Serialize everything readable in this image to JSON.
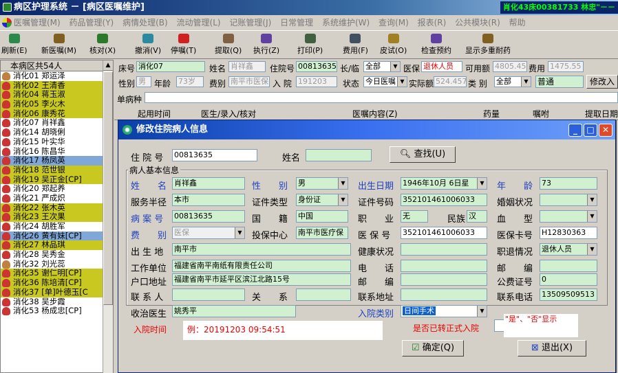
{
  "window": {
    "title": "病区护理系统 － [病区医嘱维护]",
    "status_right": "肖化43床00381733 林忠\"－－"
  },
  "menu": [
    "医嘱管理(M)",
    "药品管理(Y)",
    "病情处理(B)",
    "流动管理(L)",
    "记账管理(J)",
    "日常管理",
    "系统维护(W)",
    "查询(M)",
    "报表(R)",
    "公共模块(R)",
    "帮助"
  ],
  "toolbar": [
    {
      "label": "刷新(E)",
      "icon": "refresh-icon",
      "color": "#2a8a4a"
    },
    {
      "label": "新医嘱(M)",
      "icon": "new-order-icon",
      "color": "#806020"
    },
    {
      "label": "核对(X)",
      "icon": "check-icon",
      "color": "#2a7a2a"
    },
    {
      "label": "撤消(V)",
      "icon": "undo-icon",
      "color": "#2a8aa0"
    },
    {
      "label": "停嘱(T)",
      "icon": "stop-icon",
      "color": "#d02020"
    },
    {
      "label": "提取(Q)",
      "icon": "extract-icon",
      "color": "#806040"
    },
    {
      "label": "执行(Z)",
      "icon": "execute-icon",
      "color": "#6040a0"
    },
    {
      "label": "打印(P)",
      "icon": "print-icon",
      "color": "#406040"
    },
    {
      "label": "费用(F)",
      "icon": "fee-icon",
      "color": "#405060"
    },
    {
      "label": "皮试(O)",
      "icon": "skin-test-icon",
      "color": "#a08020"
    },
    {
      "label": "检查预约",
      "icon": "appointment-icon",
      "color": "#6040a0"
    },
    {
      "label": "显示多重耐药",
      "icon": "drug-resistance-icon",
      "color": "#806020"
    }
  ],
  "patient_list": {
    "header": "本病区共54人",
    "items": [
      {
        "text": "消化01 郑运泽",
        "state": "normal"
      },
      {
        "text": "消化02 王清香",
        "state": "hl"
      },
      {
        "text": "消化04 蒋玉淑",
        "state": "hl"
      },
      {
        "text": "消化05 李火木",
        "state": "hl"
      },
      {
        "text": "消化06 康秀花",
        "state": "hl"
      },
      {
        "text": "消化07 肖祥鑫",
        "state": "normal"
      },
      {
        "text": "消化14 胡晓俐",
        "state": "normal"
      },
      {
        "text": "消化15 叶实华",
        "state": "normal"
      },
      {
        "text": "消化16 陈昌华",
        "state": "normal"
      },
      {
        "text": "消化17 杨凤英",
        "state": "sel"
      },
      {
        "text": "消化18 范世银",
        "state": "hl"
      },
      {
        "text": "消化19 吴正金[CP]",
        "state": "hl"
      },
      {
        "text": "消化20 郑起养",
        "state": "normal"
      },
      {
        "text": "消化21 严成炽",
        "state": "normal"
      },
      {
        "text": "消化22 张木英",
        "state": "hl"
      },
      {
        "text": "消化23 王次果",
        "state": "hl"
      },
      {
        "text": "消化24 胡胜军",
        "state": "normal"
      },
      {
        "text": "消化26 黄有妹[CP]",
        "state": "sel"
      },
      {
        "text": "消化27 林品琪",
        "state": "hl"
      },
      {
        "text": "消化28 吴秀金",
        "state": "normal"
      },
      {
        "text": "消化32 刘光蕊",
        "state": "normal"
      },
      {
        "text": "消化35 谢仁明[CP]",
        "state": "hl"
      },
      {
        "text": "消化36 陈培清[CP]",
        "state": "hl"
      },
      {
        "text": "消化37 [单]叶德玉[C",
        "state": "hl"
      },
      {
        "text": "消化38 吴步霞",
        "state": "normal"
      },
      {
        "text": "消化53 杨成忠[CP]",
        "state": "normal"
      }
    ]
  },
  "order_header": {
    "bed_label": "床号",
    "bed": "消化07",
    "name_label": "姓名",
    "name": "肖祥鑫",
    "inpatient_label": "住院号",
    "inpatient": "00813635",
    "longterm_label": "长/临",
    "longterm": "全部",
    "insurance_label": "医保",
    "insurance": "退休人员",
    "available_label": "可用额",
    "available": "4805.45",
    "fee_label": "费用",
    "fee": "1475.55",
    "sex_label": "性别",
    "sex": "男",
    "age_label": "年龄",
    "age": "73岁",
    "feetype_label": "费别",
    "feetype": "南平市医保",
    "admit_label": "入 院",
    "admit": "191203",
    "status_label": "状态",
    "status": "今日医嘱",
    "actual_label": "实际额",
    "actual": "524.457",
    "category_label": "类 别",
    "category": "全部",
    "category2": "普通",
    "modify_button": "修改入",
    "disease_label": "单病种",
    "columns": [
      "起用时间",
      "医生/录入/核对",
      "医嘱内容(Z)",
      "药量",
      "嘱咐",
      "提取日期"
    ]
  },
  "dialog": {
    "title": "修改住院病人信息",
    "inpatient_label": "住 院 号",
    "inpatient": "00813635",
    "name_search_label": "姓名",
    "name_search": "",
    "search_button": "查找(U)",
    "group_label": "病人基本信息",
    "rows": {
      "name_label": "姓　　名",
      "name": "肖祥鑫",
      "sex_label": "性　　别",
      "sex": "男",
      "birth_label": "出生日期",
      "birth": "1946年10月 6日星",
      "age_label": "年　　龄",
      "age": "73",
      "area_label": "服务半径",
      "area": "本市",
      "idtype_label": "证件类型",
      "idtype": "身份证",
      "idno_label": "证件号码",
      "idno": "352101461006033",
      "marital_label": "婚姻状况",
      "marital": "",
      "record_label": "病 案 号",
      "record": "00813635",
      "country_label": "国　　籍",
      "country": "中国",
      "job_label": "职　　业",
      "job": "无",
      "nation_label": "民族",
      "nation": "汉",
      "blood_label": "血　　型",
      "blood": "",
      "feetype_label": "费　　别",
      "feetype": "医保",
      "center_label": "投保中心",
      "center": "南平市医疗保",
      "insno_label": "医 保 号",
      "insno": "352101461006033",
      "card_label": "医保卡号",
      "card": "H12830363",
      "birthplace_label": "出 生 地",
      "birthplace": "南平市",
      "health_label": "健康状况",
      "health": "",
      "retire_label": "职退情况",
      "retire": "退休人员",
      "work_label": "工作单位",
      "work": "福建省南平南纸有限责任公司",
      "tel_label": "电　　话",
      "tel": "",
      "zip1_label": "邮　　编",
      "zip1": "",
      "addr_label": "户口地址",
      "addr": "福建省南平市延平区滨江北路15号",
      "zip2_label": "邮　　编",
      "zip2": "",
      "public_label": "公费证号",
      "public": "0",
      "contact_label": "联 系 人",
      "contact": "",
      "relation_label": "关　　系",
      "relation": "",
      "contactaddr_label": "联系地址",
      "contactaddr": "",
      "contacttel_label": "联系电话",
      "contacttel": "13509509513",
      "doctor_label": "收治医生",
      "doctor": "姚秀平",
      "admittype_label": "入院类别",
      "admittype": "日间手术"
    },
    "admit_time_label": "入院时间",
    "admit_time_example": "例：20191203 09:54:51",
    "formal_label": "是否已转正式入院",
    "formal_hint": "\"是\"、\"否\"显示",
    "ok_button": "确定(Q)",
    "exit_button": "退出(X)"
  }
}
